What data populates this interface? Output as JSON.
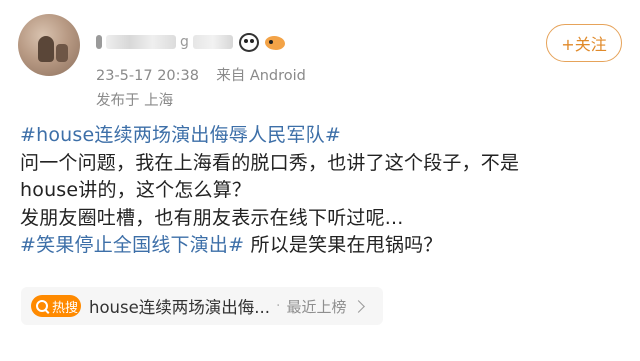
{
  "post": {
    "author": {
      "name_visible": "g"
    },
    "meta": {
      "datetime": "23-5-17 20:38",
      "source": "来自 Android",
      "location": "发布于 上海"
    },
    "follow_label": "+关注",
    "lines": {
      "l1_topic": "#house连续两场演出侮辱人民军队#",
      "l2": "问一个问题，我在上海看的脱口秀，也讲了这个段子，不是",
      "l3": "house讲的，这个怎么算？",
      "l4": "发朋友圈吐槽，也有朋友表示在线下听过呢...",
      "l5_topic": "#笑果停止全国线下演出#",
      "l5_rest": " 所以是笑果在甩锅吗？"
    }
  },
  "hot_search": {
    "badge_label": "热搜",
    "title": "house连续两场演出侮...",
    "separator": "·",
    "status": "最近上榜"
  },
  "colors": {
    "topic_link": "#3d6fa8",
    "follow_accent": "#e08a2a",
    "hot_badge": "#ff8a00"
  },
  "icons": {
    "hot_badge_icon": "search-icon",
    "hot_chevron": "chevron-right-icon",
    "emoji_1": "panda-emoji-icon",
    "emoji_2": "fish-emoji-icon"
  }
}
